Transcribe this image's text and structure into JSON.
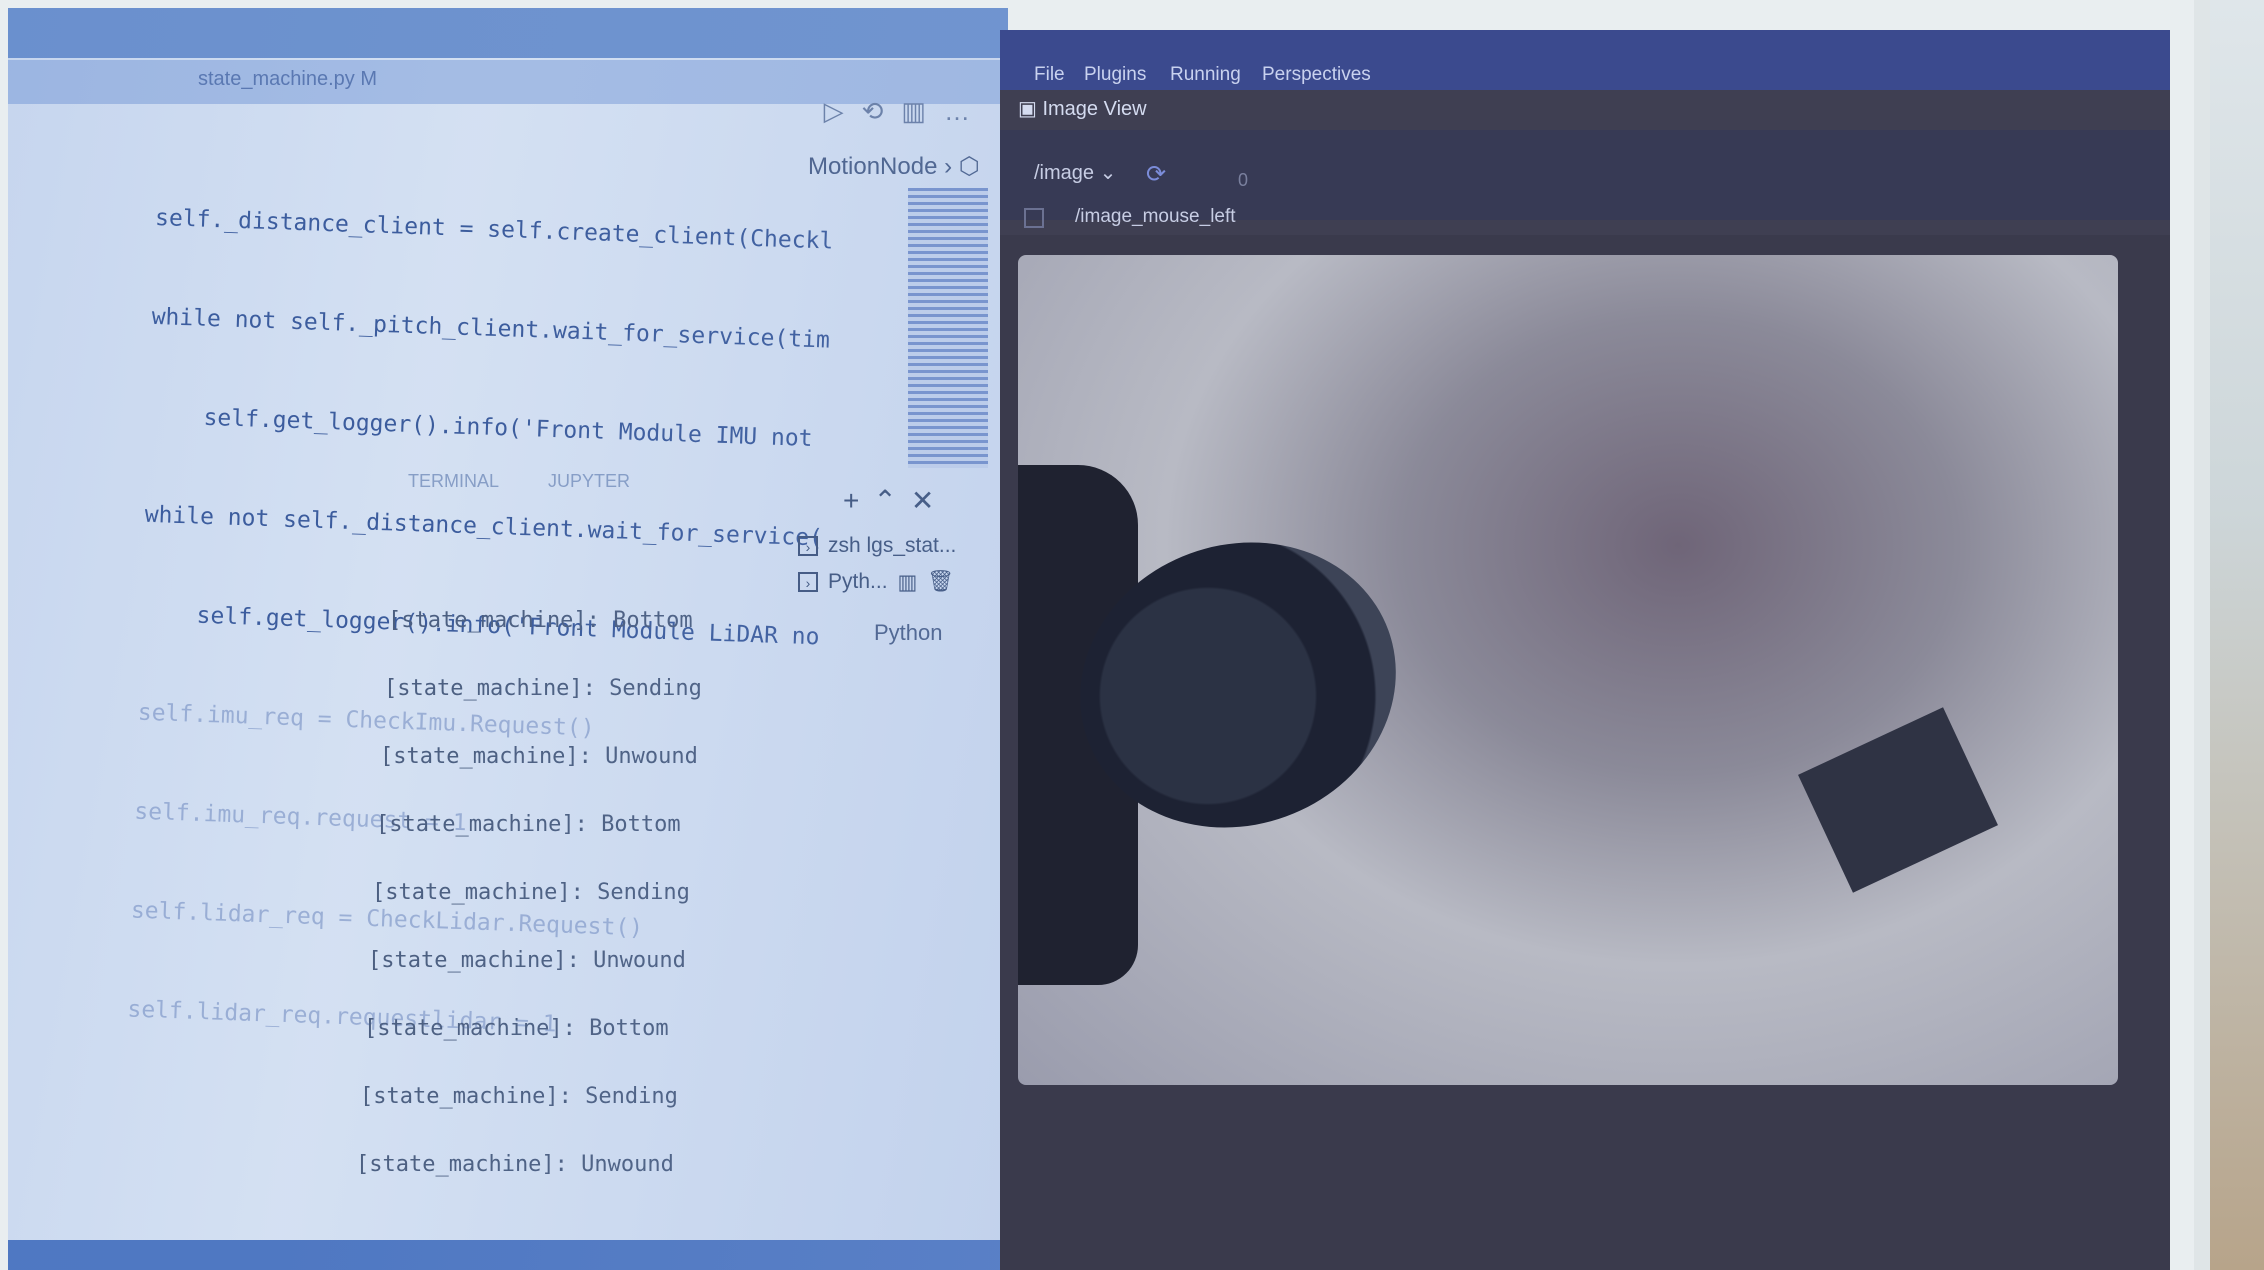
{
  "vscode": {
    "tab_label": "state_machine.py M",
    "breadcrumb": "MotionNode",
    "code_lines": [
      "self._distance_client = self.create_client(Checkl",
      "while not self._pitch_client.wait_for_service(tim",
      "    self.get_logger().info('Front Module IMU not",
      "while not self._distance_client.wait_for_service(",
      "    self.get_logger().info('Front Module LiDAR no",
      "self.imu_req = CheckImu.Request()",
      "self.imu_req.request = 1",
      "self.lidar_req = CheckLidar.Request()",
      "self.lidar_req.requestlidar = 1"
    ],
    "panel_tabs": [
      "TERMINAL",
      "JUPYTER"
    ],
    "terminals": [
      {
        "label": "zsh  lgs_stat..."
      },
      {
        "label": "Pyth..."
      }
    ],
    "python_tip": "Python",
    "terminal_lines": [
      {
        "node": "[state_machine]:",
        "msg": "Bottom"
      },
      {
        "node": "[state_machine]:",
        "msg": "Sending"
      },
      {
        "node": "[state_machine]:",
        "msg": "Unwound"
      },
      {
        "node": "[state_machine]:",
        "msg": "Bottom"
      },
      {
        "node": "[state_machine]:",
        "msg": "Sending"
      },
      {
        "node": "[state_machine]:",
        "msg": "Unwound"
      },
      {
        "node": "[state_machine]:",
        "msg": "Bottom"
      },
      {
        "node": "[state_machine]:",
        "msg": "Sending"
      },
      {
        "node": "[state_machine]:",
        "msg": "Unwound"
      }
    ]
  },
  "rqt": {
    "menu": [
      "File",
      "Plugins",
      "Running",
      "Perspectives"
    ],
    "title": "Image View",
    "topic": "/image",
    "zero": "0",
    "mouse_topic": "/image_mouse_left"
  }
}
